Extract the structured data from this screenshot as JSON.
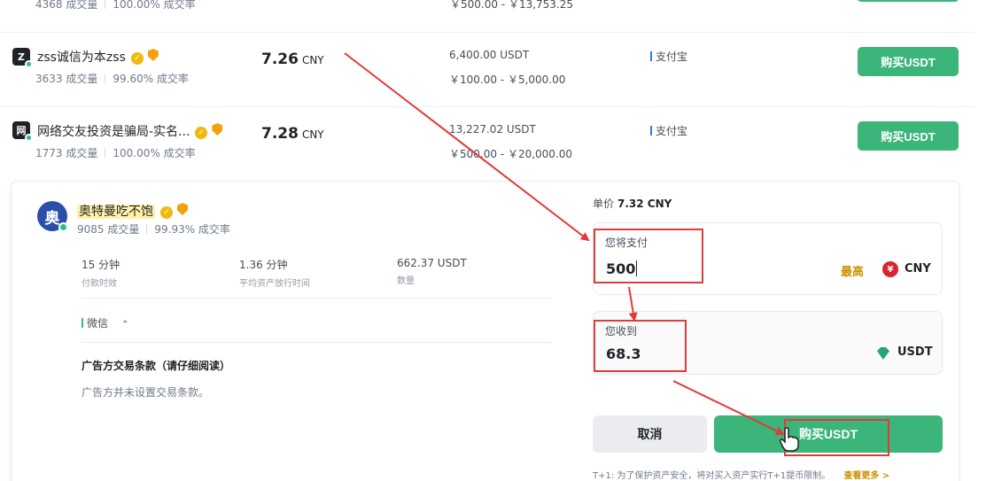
{
  "top_row": {
    "stats_trades": "4368 成交量",
    "stats_rate": "100.00% 成交率",
    "limit": "￥500.00 - ￥13,753.25"
  },
  "ads": [
    {
      "avatar_letter": "Z",
      "name": "zss诚信为本zss",
      "trades": "3633 成交量",
      "rate": "99.60% 成交率",
      "price": "7.26",
      "currency": "CNY",
      "available": "6,400.00 USDT",
      "limit": "￥100.00 - ￥5,000.00",
      "payment": "支付宝",
      "button": "购买USDT"
    },
    {
      "avatar_letter": "网",
      "name": "网络交友投资是骗局-实名...",
      "trades": "1773 成交量",
      "rate": "100.00% 成交率",
      "price": "7.28",
      "currency": "CNY",
      "available": "13,227.02 USDT",
      "limit": "￥500.00 - ￥20,000.00",
      "payment": "支付宝",
      "button": "购买USDT"
    }
  ],
  "expanded": {
    "avatar_letter": "奥",
    "name": "奥特曼吃不饱",
    "trades": "9085 成交量",
    "rate": "99.93% 成交率",
    "metrics": [
      {
        "value": "15 分钟",
        "label": "付款时效"
      },
      {
        "value": "1.36 分钟",
        "label": "平均资产放行时间"
      },
      {
        "value": "662.37 USDT",
        "label": "数量"
      }
    ],
    "payment": "微信",
    "terms_title": "广告方交易条款（请仔细阅读）",
    "terms_body": "广告方并未设置交易条款。"
  },
  "trade": {
    "unit_price_label": "单价",
    "unit_price": "7.32 CNY",
    "pay_label": "您将支付",
    "pay_value": "500",
    "max_label": "最高",
    "pay_currency": "CNY",
    "receive_label": "您收到",
    "receive_value": "68.3",
    "receive_currency": "USDT",
    "cancel": "取消",
    "confirm": "购买USDT",
    "note": "T+1: 为了保护资产安全，将对买入资产实行T+1提币限制。",
    "note_link": "查看更多 >"
  },
  "colors": {
    "buy_green": "#3bb57a",
    "annotation_red": "#e23a3a",
    "gold": "#f0b90b"
  }
}
